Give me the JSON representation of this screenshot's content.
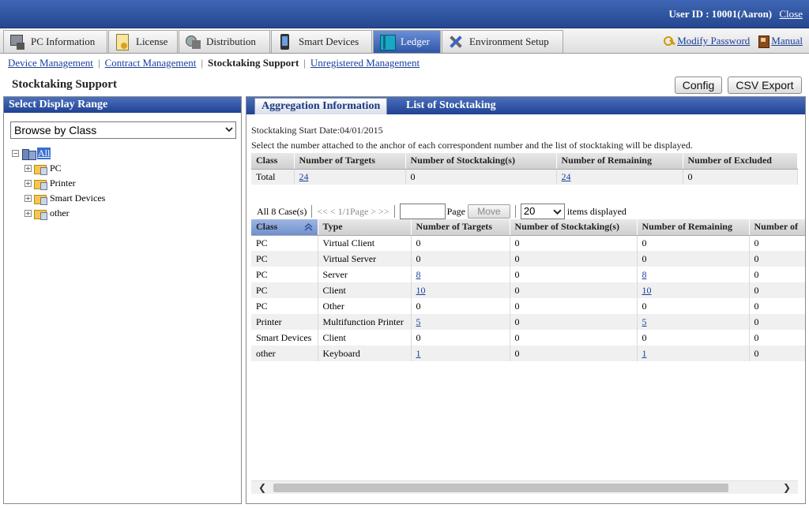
{
  "header": {
    "user_label": "User ID : 10001(Aaron)",
    "close": "Close"
  },
  "main_tabs": [
    {
      "label": "PC Information",
      "icon": "pc-icon"
    },
    {
      "label": "License",
      "icon": "license-icon"
    },
    {
      "label": "Distribution",
      "icon": "distribution-icon"
    },
    {
      "label": "Smart Devices",
      "icon": "smart-device-icon"
    },
    {
      "label": "Ledger",
      "icon": "ledger-icon"
    },
    {
      "label": "Environment Setup",
      "icon": "tools-icon"
    }
  ],
  "top_links": {
    "modify_password": "Modify Password",
    "manual": "Manual"
  },
  "subnav": {
    "device_management": "Device Management",
    "contract_management": "Contract Management",
    "stocktaking_support": "Stocktaking Support",
    "unregistered_management": "Unregistered Management"
  },
  "page": {
    "title": "Stocktaking Support",
    "config_label": "Config",
    "csv_export_label": "CSV Export"
  },
  "left_panel": {
    "title": "Select Display Range",
    "browse_value": "Browse by Class",
    "tree": {
      "root": "All",
      "children": [
        "PC",
        "Printer",
        "Smart Devices",
        "other"
      ]
    }
  },
  "right_panel": {
    "tabs": [
      "Aggregation Information",
      "List of Stocktaking"
    ],
    "start_date_text": "Stocktaking Start Date:04/01/2015",
    "instruction": "Select the number attached to the anchor of each correspondent number and the list of stocktaking will be displayed.",
    "summary": {
      "headers": [
        "Class",
        "Number of Targets",
        "Number of Stocktaking(s)",
        "Number of Remaining",
        "Number of Excluded"
      ],
      "row": {
        "class": "Total",
        "targets": "24",
        "stocktaking": "0",
        "remaining": "24",
        "excluded": "0"
      }
    },
    "pager": {
      "count": "All 8 Case(s)",
      "nav": "<< < 1/1Page > >>",
      "page_input": "",
      "page_label": "Page",
      "move": "Move",
      "items_value": "20",
      "items_label": "items displayed"
    },
    "detail": {
      "headers": [
        "Class",
        "Type",
        "Number of Targets",
        "Number of Stocktaking(s)",
        "Number of Remaining",
        "Number of"
      ],
      "rows": [
        {
          "class": "PC",
          "type": "Virtual Client",
          "targets": "0",
          "stocktaking": "0",
          "remaining": "0",
          "excluded": "0"
        },
        {
          "class": "PC",
          "type": "Virtual Server",
          "targets": "0",
          "stocktaking": "0",
          "remaining": "0",
          "excluded": "0"
        },
        {
          "class": "PC",
          "type": "Server",
          "targets": "8",
          "stocktaking": "0",
          "remaining": "8",
          "excluded": "0"
        },
        {
          "class": "PC",
          "type": "Client",
          "targets": "10",
          "stocktaking": "0",
          "remaining": "10",
          "excluded": "0"
        },
        {
          "class": "PC",
          "type": "Other",
          "targets": "0",
          "stocktaking": "0",
          "remaining": "0",
          "excluded": "0"
        },
        {
          "class": "Printer",
          "type": "Multifunction Printer",
          "targets": "5",
          "stocktaking": "0",
          "remaining": "5",
          "excluded": "0"
        },
        {
          "class": "Smart Devices",
          "type": "Client",
          "targets": "0",
          "stocktaking": "0",
          "remaining": "0",
          "excluded": "0"
        },
        {
          "class": "other",
          "type": "Keyboard",
          "targets": "1",
          "stocktaking": "0",
          "remaining": "1",
          "excluded": "0"
        }
      ]
    }
  },
  "colors": {
    "header_blue": "#24478f",
    "link_blue": "#1a3f9c",
    "active_tab": "#2e57a8"
  }
}
